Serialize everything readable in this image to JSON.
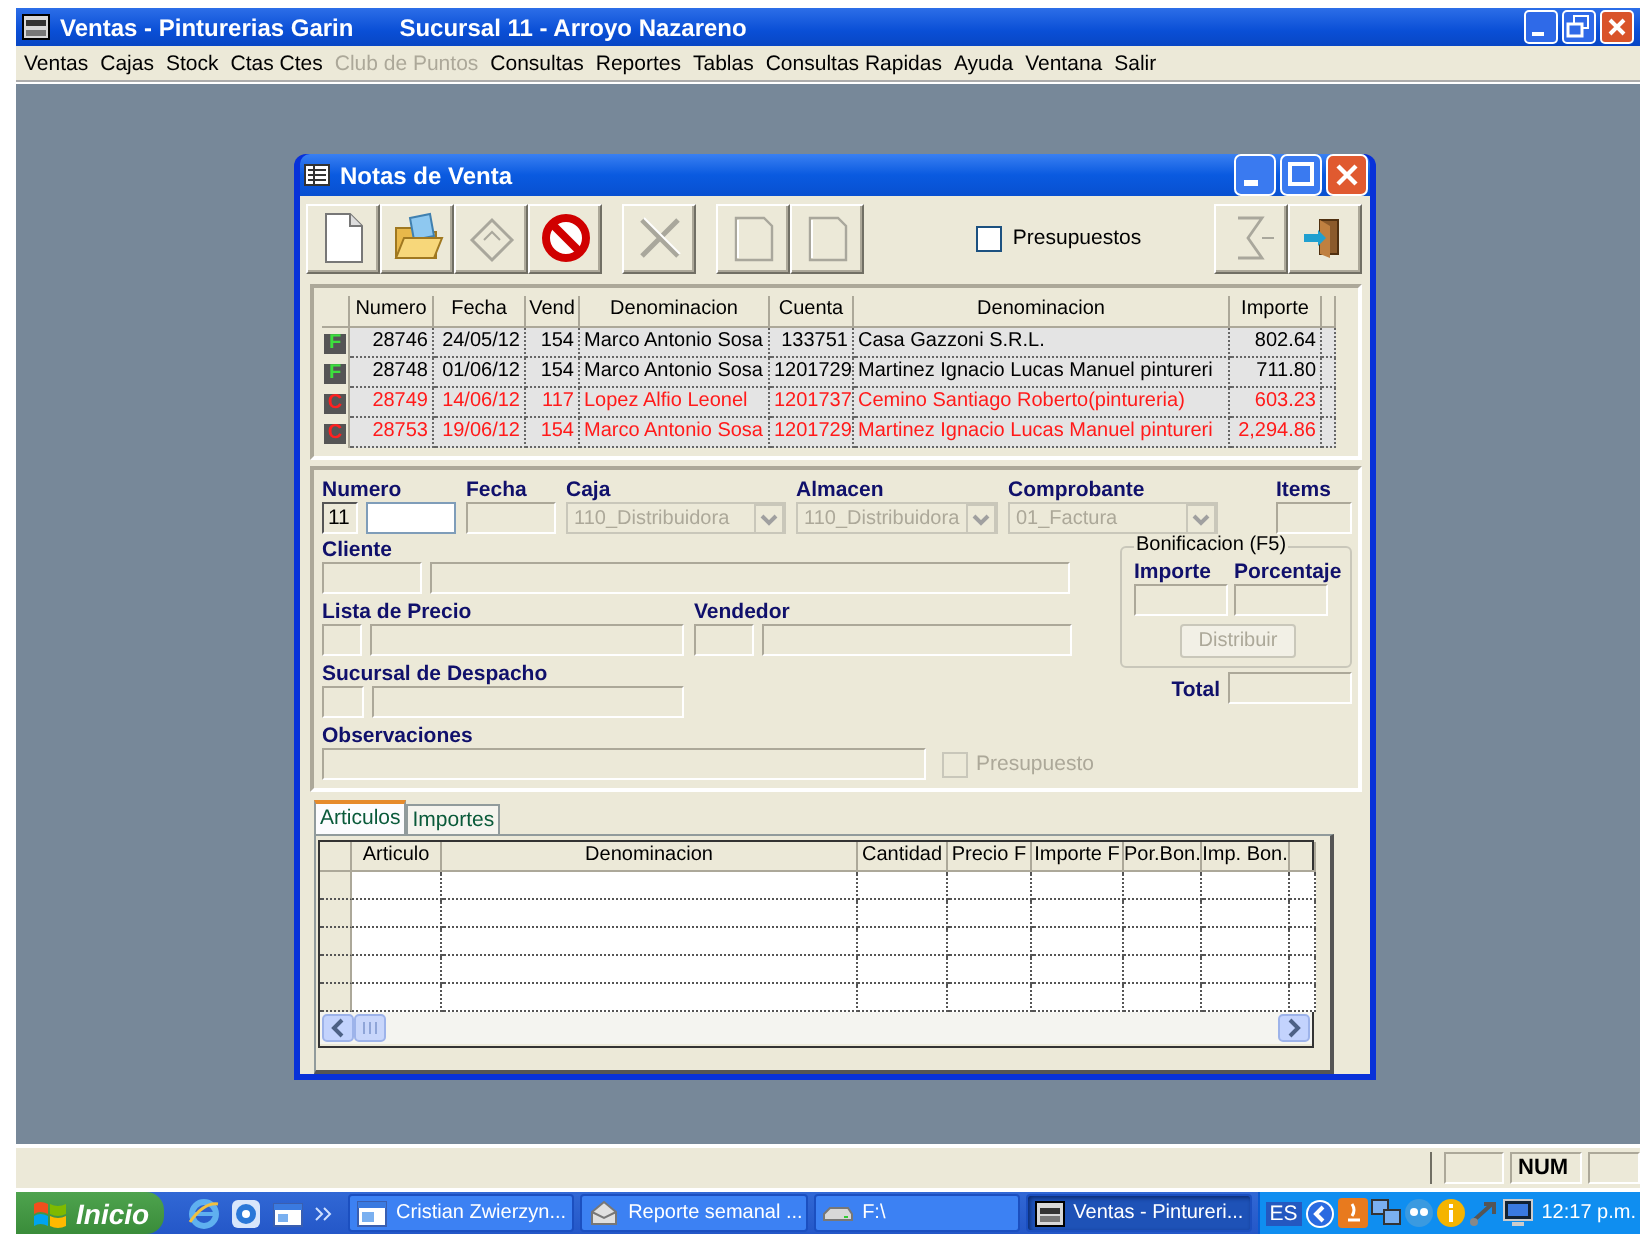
{
  "app": {
    "title": "Ventas - Pinturerias Garin",
    "subtitle": "Sucursal 11 - Arroyo Nazareno"
  },
  "menu": [
    {
      "label": "Ventas",
      "disabled": false
    },
    {
      "label": "Cajas",
      "disabled": false
    },
    {
      "label": "Stock",
      "disabled": false
    },
    {
      "label": "Ctas Ctes",
      "disabled": false
    },
    {
      "label": "Club de Puntos",
      "disabled": true
    },
    {
      "label": "Consultas",
      "disabled": false
    },
    {
      "label": "Reportes",
      "disabled": false
    },
    {
      "label": "Tablas",
      "disabled": false
    },
    {
      "label": "Consultas Rapidas",
      "disabled": false
    },
    {
      "label": "Ayuda",
      "disabled": false
    },
    {
      "label": "Ventana",
      "disabled": false
    },
    {
      "label": "Salir",
      "disabled": false
    }
  ],
  "window": {
    "title": "Notas de Venta"
  },
  "toolbar": [
    {
      "items": [
        {
          "kind": "new",
          "disabled": false
        },
        {
          "kind": "open",
          "disabled": false
        },
        {
          "kind": "save",
          "disabled": true
        },
        {
          "kind": "cancel",
          "disabled": false
        }
      ]
    },
    {
      "items": [
        {
          "kind": "cut",
          "disabled": true
        }
      ]
    },
    {
      "items": [
        {
          "kind": "page",
          "disabled": true
        },
        {
          "kind": "page",
          "disabled": true
        }
      ]
    },
    {
      "items": [
        {
          "kind": "checkbox",
          "label": "Presupuestos",
          "checked": false
        }
      ]
    },
    {
      "items": [
        {
          "kind": "sum",
          "disabled": true
        },
        {
          "kind": "exit",
          "disabled": false
        }
      ]
    }
  ],
  "notes_table": {
    "columns": [
      "Numero",
      "Fecha",
      "Vend",
      "Denominacion",
      "Cuenta",
      "Denominacion",
      "Importe"
    ],
    "rows": [
      {
        "kind": "factura",
        "flag": "F",
        "cells": [
          "28746",
          "24/05/12",
          "154",
          "Marco Antonio Sosa",
          "133751",
          "Casa Gazzoni S.R.L.",
          "802.64"
        ]
      },
      {
        "kind": "factura",
        "flag": "F",
        "cells": [
          "28748",
          "01/06/12",
          "154",
          "Marco Antonio Sosa",
          "1201729",
          "Martinez Ignacio Lucas Manuel pintureri",
          "711.80"
        ]
      },
      {
        "kind": "credito",
        "flag": "C",
        "cells": [
          "28749",
          "14/06/12",
          "117",
          "Lopez Alfio Leonel",
          "1201737",
          "Cemino Santiago Roberto(pintureria)",
          "603.23"
        ]
      },
      {
        "kind": "credito",
        "flag": "C",
        "cells": [
          "28753",
          "19/06/12",
          "154",
          "Marco Antonio Sosa",
          "1201729",
          "Martinez Ignacio Lucas Manuel pintureri",
          "2,294.86"
        ]
      }
    ]
  },
  "form": {
    "numero": {
      "label": "Numero",
      "branch": "11"
    },
    "fecha": {
      "label": "Fecha"
    },
    "caja": {
      "label": "Caja",
      "value": "110_Distribuidora",
      "disabled": true
    },
    "almacen": {
      "label": "Almacen",
      "value": "110_Distribuidora",
      "disabled": true
    },
    "comprobante": {
      "label": "Comprobante",
      "value": "01_Factura",
      "disabled": true
    },
    "items": {
      "label": "Items"
    },
    "cliente": {
      "label": "Cliente"
    },
    "lista_de_precio": {
      "label": "Lista de Precio"
    },
    "vendedor": {
      "label": "Vendedor"
    },
    "sucursal_de_despacho": {
      "label": "Sucursal de Despacho"
    },
    "observaciones": {
      "label": "Observaciones"
    },
    "presupuesto": {
      "label": "Presupuesto",
      "checked": false,
      "disabled": true
    },
    "bonificacion": {
      "title": "Bonificacion (F5)",
      "importe_label": "Importe",
      "porcentaje_label": "Porcentaje",
      "button": {
        "label": "Distribuir",
        "disabled": true
      }
    },
    "total": {
      "label": "Total"
    }
  },
  "tabs": [
    {
      "label": "Articulos",
      "selected": true
    },
    {
      "label": "Importes",
      "selected": false
    }
  ],
  "items_table": {
    "columns": [
      "Articulo",
      "Denominacion",
      "Cantidad",
      "Precio F",
      "Importe F",
      "Por.Bon.",
      "Imp. Bon."
    ]
  },
  "status_bar": {
    "indicator": "NUM"
  },
  "taskbar": {
    "start": "Inicio",
    "tasks": [
      {
        "kind": "window",
        "label": "Cristian Zwierzyn...",
        "selected": false
      },
      {
        "kind": "mail",
        "label": "Reporte semanal ...",
        "selected": false
      },
      {
        "kind": "drive",
        "label": "F:\\",
        "selected": false
      },
      {
        "kind": "app",
        "label": "Ventas - Pintureri...",
        "selected": true
      }
    ],
    "language": "ES",
    "clock": "12:17 p.m."
  }
}
